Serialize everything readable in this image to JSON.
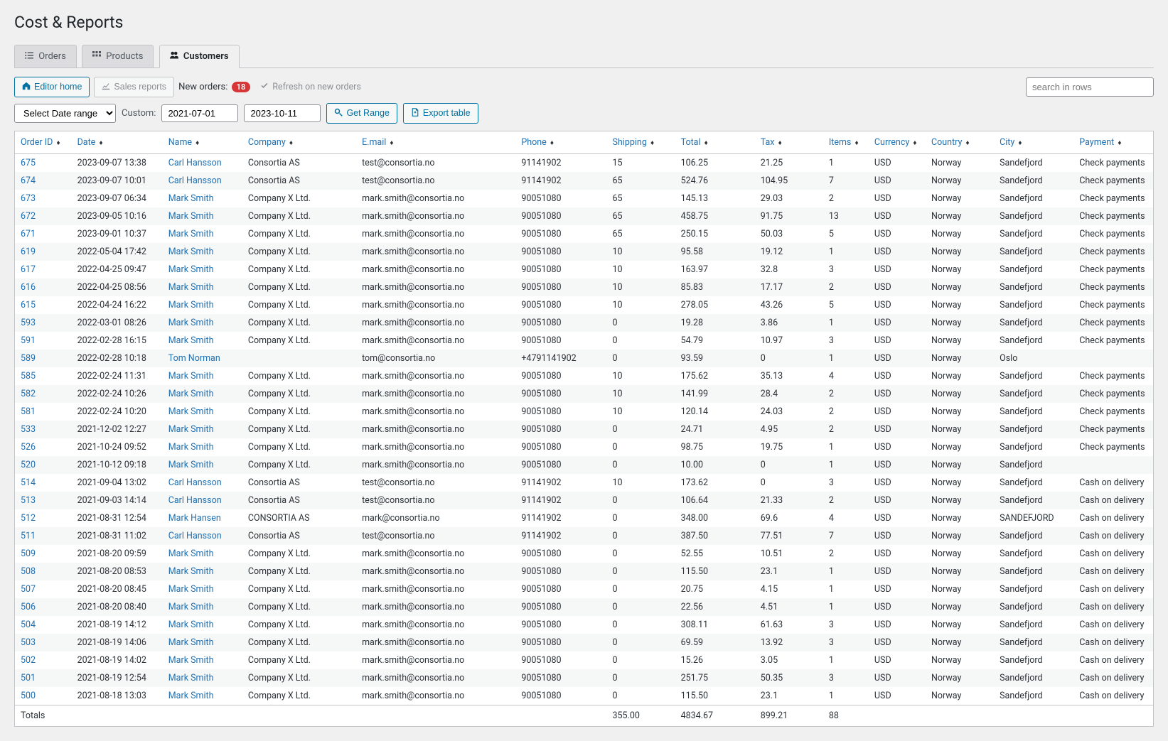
{
  "page_title": "Cost & Reports",
  "tabs": [
    {
      "id": "orders",
      "label": "Orders",
      "active": false
    },
    {
      "id": "products",
      "label": "Products",
      "active": false
    },
    {
      "id": "customers",
      "label": "Customers",
      "active": true
    }
  ],
  "toolbar": {
    "editor_home": "Editor home",
    "sales_reports": "Sales reports",
    "new_orders_label": "New orders:",
    "new_orders_count": "18",
    "refresh_label": "Refresh on new orders",
    "search_placeholder": "search in rows"
  },
  "range_bar": {
    "select_label": "Select Date range",
    "custom_label": "Custom:",
    "date_from": "2021-07-01",
    "date_to": "2023-10-11",
    "get_range": "Get Range",
    "export_table": "Export table"
  },
  "columns": [
    {
      "key": "order_id",
      "label": "Order ID",
      "width": "5%"
    },
    {
      "key": "date",
      "label": "Date",
      "width": "8%"
    },
    {
      "key": "name",
      "label": "Name",
      "width": "7%"
    },
    {
      "key": "company",
      "label": "Company",
      "width": "10%"
    },
    {
      "key": "email",
      "label": "E.mail",
      "width": "14%"
    },
    {
      "key": "phone",
      "label": "Phone",
      "width": "8%"
    },
    {
      "key": "shipping",
      "label": "Shipping",
      "width": "6%"
    },
    {
      "key": "total",
      "label": "Total",
      "width": "7%"
    },
    {
      "key": "tax",
      "label": "Tax",
      "width": "6%"
    },
    {
      "key": "items",
      "label": "Items",
      "width": "4%"
    },
    {
      "key": "currency",
      "label": "Currency",
      "width": "5%"
    },
    {
      "key": "country",
      "label": "Country",
      "width": "6%"
    },
    {
      "key": "city",
      "label": "City",
      "width": "7%"
    },
    {
      "key": "payment",
      "label": "Payment",
      "width": "7%"
    }
  ],
  "rows": [
    {
      "order_id": "675",
      "date": "2023-09-07 13:38",
      "name": "Carl Hansson",
      "company": "Consortia AS",
      "email": "test@consortia.no",
      "phone": "91141902",
      "shipping": "15",
      "total": "106.25",
      "tax": "21.25",
      "items": "1",
      "currency": "USD",
      "country": "Norway",
      "city": "Sandefjord",
      "payment": "Check payments"
    },
    {
      "order_id": "674",
      "date": "2023-09-07 10:01",
      "name": "Carl Hansson",
      "company": "Consortia AS",
      "email": "test@consortia.no",
      "phone": "91141902",
      "shipping": "65",
      "total": "524.76",
      "tax": "104.95",
      "items": "7",
      "currency": "USD",
      "country": "Norway",
      "city": "Sandefjord",
      "payment": "Check payments"
    },
    {
      "order_id": "673",
      "date": "2023-09-07 06:34",
      "name": "Mark Smith",
      "company": "Company X Ltd.",
      "email": "mark.smith@consortia.no",
      "phone": "90051080",
      "shipping": "65",
      "total": "145.13",
      "tax": "29.03",
      "items": "2",
      "currency": "USD",
      "country": "Norway",
      "city": "Sandefjord",
      "payment": "Check payments"
    },
    {
      "order_id": "672",
      "date": "2023-09-05 10:16",
      "name": "Mark Smith",
      "company": "Company X Ltd.",
      "email": "mark.smith@consortia.no",
      "phone": "90051080",
      "shipping": "65",
      "total": "458.75",
      "tax": "91.75",
      "items": "13",
      "currency": "USD",
      "country": "Norway",
      "city": "Sandefjord",
      "payment": "Check payments"
    },
    {
      "order_id": "671",
      "date": "2023-09-01 10:37",
      "name": "Mark Smith",
      "company": "Company X Ltd.",
      "email": "mark.smith@consortia.no",
      "phone": "90051080",
      "shipping": "65",
      "total": "250.15",
      "tax": "50.03",
      "items": "5",
      "currency": "USD",
      "country": "Norway",
      "city": "Sandefjord",
      "payment": "Check payments"
    },
    {
      "order_id": "619",
      "date": "2022-05-04 17:42",
      "name": "Mark Smith",
      "company": "Company X Ltd.",
      "email": "mark.smith@consortia.no",
      "phone": "90051080",
      "shipping": "10",
      "total": "95.58",
      "tax": "19.12",
      "items": "1",
      "currency": "USD",
      "country": "Norway",
      "city": "Sandefjord",
      "payment": "Check payments"
    },
    {
      "order_id": "617",
      "date": "2022-04-25 09:47",
      "name": "Mark Smith",
      "company": "Company X Ltd.",
      "email": "mark.smith@consortia.no",
      "phone": "90051080",
      "shipping": "10",
      "total": "163.97",
      "tax": "32.8",
      "items": "3",
      "currency": "USD",
      "country": "Norway",
      "city": "Sandefjord",
      "payment": "Check payments"
    },
    {
      "order_id": "616",
      "date": "2022-04-25 08:56",
      "name": "Mark Smith",
      "company": "Company X Ltd.",
      "email": "mark.smith@consortia.no",
      "phone": "90051080",
      "shipping": "10",
      "total": "85.83",
      "tax": "17.17",
      "items": "2",
      "currency": "USD",
      "country": "Norway",
      "city": "Sandefjord",
      "payment": "Check payments"
    },
    {
      "order_id": "615",
      "date": "2022-04-24 16:22",
      "name": "Mark Smith",
      "company": "Company X Ltd.",
      "email": "mark.smith@consortia.no",
      "phone": "90051080",
      "shipping": "10",
      "total": "278.05",
      "tax": "43.26",
      "items": "5",
      "currency": "USD",
      "country": "Norway",
      "city": "Sandefjord",
      "payment": "Check payments"
    },
    {
      "order_id": "593",
      "date": "2022-03-01 08:26",
      "name": "Mark Smith",
      "company": "Company X Ltd.",
      "email": "mark.smith@consortia.no",
      "phone": "90051080",
      "shipping": "0",
      "total": "19.28",
      "tax": "3.86",
      "items": "1",
      "currency": "USD",
      "country": "Norway",
      "city": "Sandefjord",
      "payment": "Check payments"
    },
    {
      "order_id": "591",
      "date": "2022-02-28 16:15",
      "name": "Mark Smith",
      "company": "Company X Ltd.",
      "email": "mark.smith@consortia.no",
      "phone": "90051080",
      "shipping": "0",
      "total": "54.79",
      "tax": "10.97",
      "items": "3",
      "currency": "USD",
      "country": "Norway",
      "city": "Sandefjord",
      "payment": "Check payments"
    },
    {
      "order_id": "589",
      "date": "2022-02-28 10:18",
      "name": "Tom Norman",
      "company": "",
      "email": "tom@consortia.no",
      "phone": "+4791141902",
      "shipping": "0",
      "total": "93.59",
      "tax": "0",
      "items": "1",
      "currency": "USD",
      "country": "Norway",
      "city": "Oslo",
      "payment": ""
    },
    {
      "order_id": "585",
      "date": "2022-02-24 11:31",
      "name": "Mark Smith",
      "company": "Company X Ltd.",
      "email": "mark.smith@consortia.no",
      "phone": "90051080",
      "shipping": "10",
      "total": "175.62",
      "tax": "35.13",
      "items": "4",
      "currency": "USD",
      "country": "Norway",
      "city": "Sandefjord",
      "payment": "Check payments"
    },
    {
      "order_id": "582",
      "date": "2022-02-24 10:26",
      "name": "Mark Smith",
      "company": "Company X Ltd.",
      "email": "mark.smith@consortia.no",
      "phone": "90051080",
      "shipping": "10",
      "total": "141.99",
      "tax": "28.4",
      "items": "2",
      "currency": "USD",
      "country": "Norway",
      "city": "Sandefjord",
      "payment": "Check payments"
    },
    {
      "order_id": "581",
      "date": "2022-02-24 10:20",
      "name": "Mark Smith",
      "company": "Company X Ltd.",
      "email": "mark.smith@consortia.no",
      "phone": "90051080",
      "shipping": "10",
      "total": "120.14",
      "tax": "24.03",
      "items": "2",
      "currency": "USD",
      "country": "Norway",
      "city": "Sandefjord",
      "payment": "Check payments"
    },
    {
      "order_id": "533",
      "date": "2021-12-02 12:27",
      "name": "Mark Smith",
      "company": "Company X Ltd.",
      "email": "mark.smith@consortia.no",
      "phone": "90051080",
      "shipping": "0",
      "total": "24.71",
      "tax": "4.95",
      "items": "2",
      "currency": "USD",
      "country": "Norway",
      "city": "Sandefjord",
      "payment": "Check payments"
    },
    {
      "order_id": "526",
      "date": "2021-10-24 09:52",
      "name": "Mark Smith",
      "company": "Company X Ltd.",
      "email": "mark.smith@consortia.no",
      "phone": "90051080",
      "shipping": "0",
      "total": "98.75",
      "tax": "19.75",
      "items": "1",
      "currency": "USD",
      "country": "Norway",
      "city": "Sandefjord",
      "payment": "Check payments"
    },
    {
      "order_id": "520",
      "date": "2021-10-12 09:18",
      "name": "Mark Smith",
      "company": "Company X Ltd.",
      "email": "mark.smith@consortia.no",
      "phone": "90051080",
      "shipping": "0",
      "total": "10.00",
      "tax": "0",
      "items": "1",
      "currency": "USD",
      "country": "Norway",
      "city": "Sandefjord",
      "payment": ""
    },
    {
      "order_id": "514",
      "date": "2021-09-04 13:02",
      "name": "Carl Hansson",
      "company": "Consortia AS",
      "email": "test@consortia.no",
      "phone": "91141902",
      "shipping": "10",
      "total": "173.62",
      "tax": "0",
      "items": "3",
      "currency": "USD",
      "country": "Norway",
      "city": "Sandefjord",
      "payment": "Cash on delivery"
    },
    {
      "order_id": "513",
      "date": "2021-09-03 14:14",
      "name": "Carl Hansson",
      "company": "Consortia AS",
      "email": "test@consortia.no",
      "phone": "91141902",
      "shipping": "0",
      "total": "106.64",
      "tax": "21.33",
      "items": "2",
      "currency": "USD",
      "country": "Norway",
      "city": "Sandefjord",
      "payment": "Cash on delivery"
    },
    {
      "order_id": "512",
      "date": "2021-08-31 12:54",
      "name": "Mark Hansen",
      "company": "CONSORTIA AS",
      "email": "mark@consortia.no",
      "phone": "91141902",
      "shipping": "0",
      "total": "348.00",
      "tax": "69.6",
      "items": "4",
      "currency": "USD",
      "country": "Norway",
      "city": "SANDEFJORD",
      "payment": "Cash on delivery"
    },
    {
      "order_id": "511",
      "date": "2021-08-31 11:02",
      "name": "Carl Hansson",
      "company": "Consortia AS",
      "email": "test@consortia.no",
      "phone": "91141902",
      "shipping": "0",
      "total": "387.50",
      "tax": "77.51",
      "items": "7",
      "currency": "USD",
      "country": "Norway",
      "city": "Sandefjord",
      "payment": "Cash on delivery"
    },
    {
      "order_id": "509",
      "date": "2021-08-20 09:59",
      "name": "Mark Smith",
      "company": "Company X Ltd.",
      "email": "mark.smith@consortia.no",
      "phone": "90051080",
      "shipping": "0",
      "total": "52.55",
      "tax": "10.51",
      "items": "2",
      "currency": "USD",
      "country": "Norway",
      "city": "Sandefjord",
      "payment": "Cash on delivery"
    },
    {
      "order_id": "508",
      "date": "2021-08-20 08:53",
      "name": "Mark Smith",
      "company": "Company X Ltd.",
      "email": "mark.smith@consortia.no",
      "phone": "90051080",
      "shipping": "0",
      "total": "115.50",
      "tax": "23.1",
      "items": "1",
      "currency": "USD",
      "country": "Norway",
      "city": "Sandefjord",
      "payment": "Cash on delivery"
    },
    {
      "order_id": "507",
      "date": "2021-08-20 08:45",
      "name": "Mark Smith",
      "company": "Company X Ltd.",
      "email": "mark.smith@consortia.no",
      "phone": "90051080",
      "shipping": "0",
      "total": "20.75",
      "tax": "4.15",
      "items": "1",
      "currency": "USD",
      "country": "Norway",
      "city": "Sandefjord",
      "payment": "Cash on delivery"
    },
    {
      "order_id": "506",
      "date": "2021-08-20 08:40",
      "name": "Mark Smith",
      "company": "Company X Ltd.",
      "email": "mark.smith@consortia.no",
      "phone": "90051080",
      "shipping": "0",
      "total": "22.56",
      "tax": "4.51",
      "items": "1",
      "currency": "USD",
      "country": "Norway",
      "city": "Sandefjord",
      "payment": "Cash on delivery"
    },
    {
      "order_id": "504",
      "date": "2021-08-19 14:12",
      "name": "Mark Smith",
      "company": "Company X Ltd.",
      "email": "mark.smith@consortia.no",
      "phone": "90051080",
      "shipping": "0",
      "total": "308.11",
      "tax": "61.63",
      "items": "3",
      "currency": "USD",
      "country": "Norway",
      "city": "Sandefjord",
      "payment": "Cash on delivery"
    },
    {
      "order_id": "503",
      "date": "2021-08-19 14:06",
      "name": "Mark Smith",
      "company": "Company X Ltd.",
      "email": "mark.smith@consortia.no",
      "phone": "90051080",
      "shipping": "0",
      "total": "69.59",
      "tax": "13.92",
      "items": "3",
      "currency": "USD",
      "country": "Norway",
      "city": "Sandefjord",
      "payment": "Cash on delivery"
    },
    {
      "order_id": "502",
      "date": "2021-08-19 14:02",
      "name": "Mark Smith",
      "company": "Company X Ltd.",
      "email": "mark.smith@consortia.no",
      "phone": "90051080",
      "shipping": "0",
      "total": "15.26",
      "tax": "3.05",
      "items": "1",
      "currency": "USD",
      "country": "Norway",
      "city": "Sandefjord",
      "payment": "Cash on delivery"
    },
    {
      "order_id": "501",
      "date": "2021-08-19 12:54",
      "name": "Mark Smith",
      "company": "Company X Ltd.",
      "email": "mark.smith@consortia.no",
      "phone": "90051080",
      "shipping": "0",
      "total": "251.75",
      "tax": "50.35",
      "items": "3",
      "currency": "USD",
      "country": "Norway",
      "city": "Sandefjord",
      "payment": "Cash on delivery"
    },
    {
      "order_id": "500",
      "date": "2021-08-18 13:03",
      "name": "Mark Smith",
      "company": "Company X Ltd.",
      "email": "mark.smith@consortia.no",
      "phone": "90051080",
      "shipping": "0",
      "total": "115.50",
      "tax": "23.1",
      "items": "1",
      "currency": "USD",
      "country": "Norway",
      "city": "Sandefjord",
      "payment": "Cash on delivery"
    }
  ],
  "totals": {
    "label": "Totals",
    "shipping": "355.00",
    "total": "4834.67",
    "tax": "899.21",
    "items": "88"
  }
}
